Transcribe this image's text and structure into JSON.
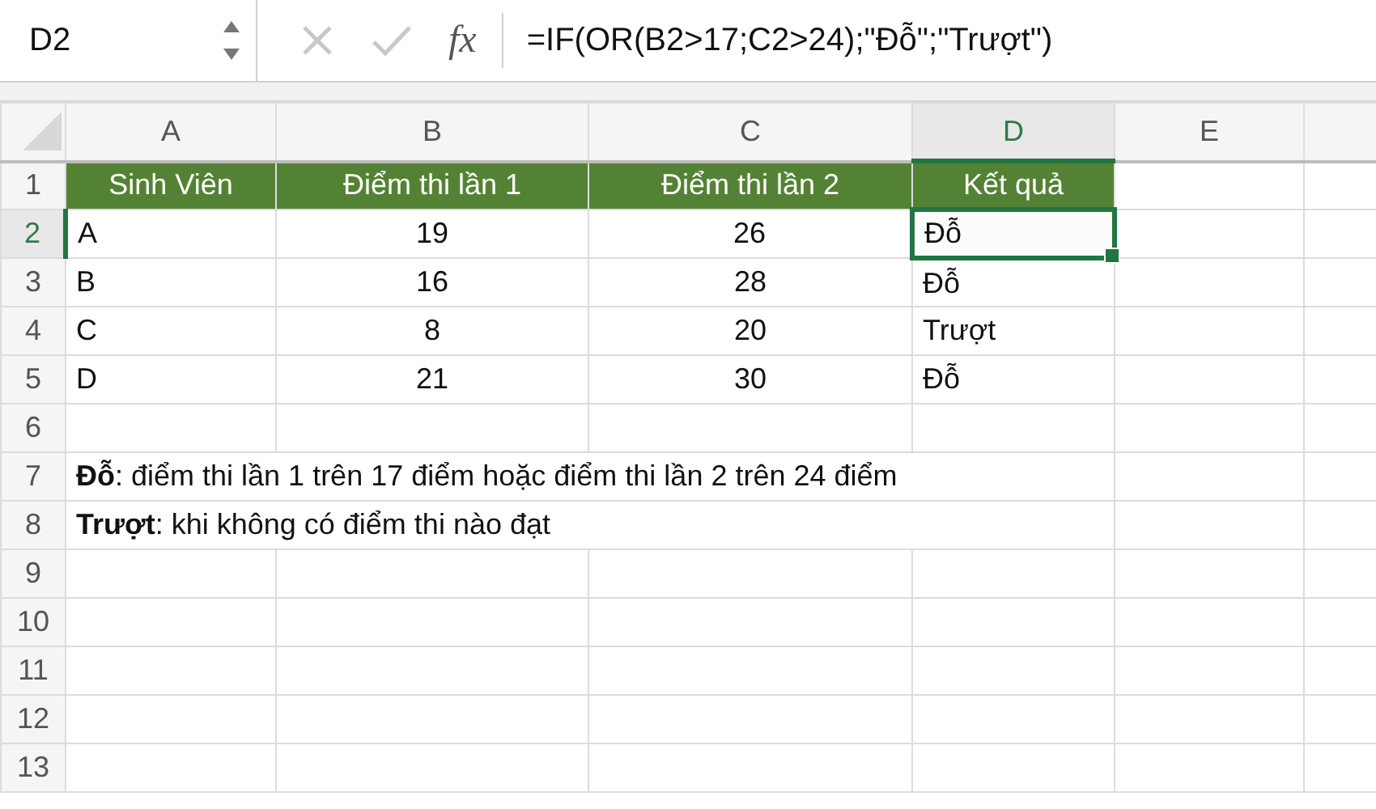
{
  "name_box": "D2",
  "formula_bar": {
    "fx": "fx",
    "formula": "=IF(OR(B2>17;C2>24);\"Đỗ\";\"Trượt\")"
  },
  "columns": [
    {
      "label": "A",
      "selected": false
    },
    {
      "label": "B",
      "selected": false
    },
    {
      "label": "C",
      "selected": false
    },
    {
      "label": "D",
      "selected": true
    },
    {
      "label": "E",
      "selected": false
    }
  ],
  "rows": [
    {
      "number": "1",
      "selected": false,
      "kind": "header",
      "cells": [
        {
          "text": "Sinh Viên",
          "selected": false
        },
        {
          "text": "Điểm thi lần 1",
          "selected": false
        },
        {
          "text": "Điểm thi lần 2",
          "selected": false
        },
        {
          "text": "Kết quả",
          "selected": false
        }
      ]
    },
    {
      "number": "2",
      "selected": true,
      "kind": "data",
      "cells": [
        {
          "text": "A",
          "selected": false
        },
        {
          "text": "19",
          "selected": false
        },
        {
          "text": "26",
          "selected": false
        },
        {
          "text": "Đỗ",
          "selected": true
        }
      ]
    },
    {
      "number": "3",
      "selected": false,
      "kind": "data",
      "cells": [
        {
          "text": "B",
          "selected": false
        },
        {
          "text": "16",
          "selected": false
        },
        {
          "text": "28",
          "selected": false
        },
        {
          "text": "Đỗ",
          "selected": false
        }
      ]
    },
    {
      "number": "4",
      "selected": false,
      "kind": "data",
      "cells": [
        {
          "text": "C",
          "selected": false
        },
        {
          "text": "8",
          "selected": false
        },
        {
          "text": "20",
          "selected": false
        },
        {
          "text": "Trượt",
          "selected": false
        }
      ]
    },
    {
      "number": "5",
      "selected": false,
      "kind": "data",
      "cells": [
        {
          "text": "D",
          "selected": false
        },
        {
          "text": "21",
          "selected": false
        },
        {
          "text": "30",
          "selected": false
        },
        {
          "text": "Đỗ",
          "selected": false
        }
      ]
    },
    {
      "number": "6",
      "selected": false,
      "kind": "empty"
    },
    {
      "number": "7",
      "selected": false,
      "kind": "note",
      "text": "**Đỗ**: điểm thi lần 1 trên 17 điểm hoặc điểm thi lần 2 trên 24 điểm"
    },
    {
      "number": "8",
      "selected": false,
      "kind": "note",
      "text": "**Trượt**: khi không có điểm thi nào đạt"
    },
    {
      "number": "9",
      "selected": false,
      "kind": "empty"
    },
    {
      "number": "10",
      "selected": false,
      "kind": "empty"
    },
    {
      "number": "11",
      "selected": false,
      "kind": "empty"
    },
    {
      "number": "12",
      "selected": false,
      "kind": "empty"
    },
    {
      "number": "13",
      "selected": false,
      "kind": "empty"
    }
  ]
}
